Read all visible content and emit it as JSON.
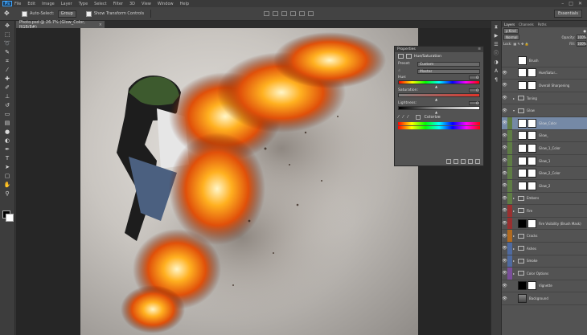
{
  "app": {
    "logo": "Ps"
  },
  "menu": [
    "File",
    "Edit",
    "Image",
    "Layer",
    "Type",
    "Select",
    "Filter",
    "3D",
    "View",
    "Window",
    "Help"
  ],
  "options_bar": {
    "auto_select_label": "Auto-Select:",
    "auto_select_value": "Group",
    "transform_label": "Show Transform Controls",
    "workspace": "Essentials"
  },
  "document_tab": {
    "title": "Photo.psd @ 26.7% (Glow_Color, RGB/8#)",
    "close": "×"
  },
  "properties": {
    "header": "Properties",
    "title": "Hue/Saturation",
    "preset_label": "Preset:",
    "preset_value": "Custom",
    "channel_value": "Master",
    "hue_label": "Hue:",
    "hue_value": "0",
    "saturation_label": "Saturation:",
    "saturation_value": "0",
    "lightness_label": "Lightness:",
    "lightness_value": "0",
    "colorize_label": "Colorize"
  },
  "layers_panel": {
    "tabs": [
      "Layers",
      "Channels",
      "Paths"
    ],
    "kind": "ρ Kind",
    "blend": "Normal",
    "opacity_label": "Opacity:",
    "opacity": "100%",
    "lock_label": "Lock:",
    "fill_label": "Fill:",
    "fill": "100%",
    "rows": [
      {
        "name": "Brush",
        "tag": "#535353",
        "eye": "",
        "thumb": "white",
        "arrow": ""
      },
      {
        "name": "Hue/Satur...",
        "tag": "#535353",
        "eye": "👁",
        "thumb": "white",
        "arrow": ""
      },
      {
        "name": "Overall Sharpening",
        "tag": "#535353",
        "eye": "👁",
        "thumb": "white",
        "arrow": ""
      },
      {
        "name": "Toning",
        "tag": "#535353",
        "eye": "👁",
        "thumb": "folder",
        "arrow": "▸"
      },
      {
        "name": "Glow",
        "tag": "#535353",
        "eye": "👁",
        "thumb": "folder",
        "arrow": "▾"
      },
      {
        "name": "Glow_Color",
        "tag": "#5f7d45",
        "eye": "👁",
        "thumb": "white",
        "arrow": "",
        "selected": true
      },
      {
        "name": "Glow_",
        "tag": "#5f7d45",
        "eye": "👁",
        "thumb": "white",
        "arrow": ""
      },
      {
        "name": "Glow_1_Color",
        "tag": "#5f7d45",
        "eye": "👁",
        "thumb": "white",
        "arrow": ""
      },
      {
        "name": "Glow_1",
        "tag": "#5f7d45",
        "eye": "👁",
        "thumb": "white",
        "arrow": ""
      },
      {
        "name": "Glow_2_Color",
        "tag": "#5f7d45",
        "eye": "👁",
        "thumb": "white",
        "arrow": ""
      },
      {
        "name": "Glow_2",
        "tag": "#5f7d45",
        "eye": "👁",
        "thumb": "white",
        "arrow": ""
      },
      {
        "name": "Embers",
        "tag": "#5f7d45",
        "eye": "👁",
        "thumb": "folder",
        "arrow": "▸"
      },
      {
        "name": "Fire",
        "tag": "#9a3030",
        "eye": "👁",
        "thumb": "folder",
        "arrow": "▸"
      },
      {
        "name": "Fire Visibility (Brush Mask)",
        "tag": "#9a3030",
        "eye": "👁",
        "thumb": "black",
        "arrow": ""
      },
      {
        "name": "Cracks",
        "tag": "#b06a20",
        "eye": "👁",
        "thumb": "folder",
        "arrow": "▸"
      },
      {
        "name": "Ashes",
        "tag": "#4f6aa0",
        "eye": "👁",
        "thumb": "folder",
        "arrow": "▸"
      },
      {
        "name": "Smoke",
        "tag": "#4f6aa0",
        "eye": "👁",
        "thumb": "folder",
        "arrow": "▸"
      },
      {
        "name": "Color Options",
        "tag": "#7a4f9a",
        "eye": "👁",
        "thumb": "folder",
        "arrow": "▸"
      },
      {
        "name": "Vignette",
        "tag": "#535353",
        "eye": "👁",
        "thumb": "black",
        "arrow": ""
      },
      {
        "name": "Background",
        "tag": "#535353",
        "eye": "👁",
        "thumb": "photo",
        "arrow": ""
      }
    ]
  }
}
